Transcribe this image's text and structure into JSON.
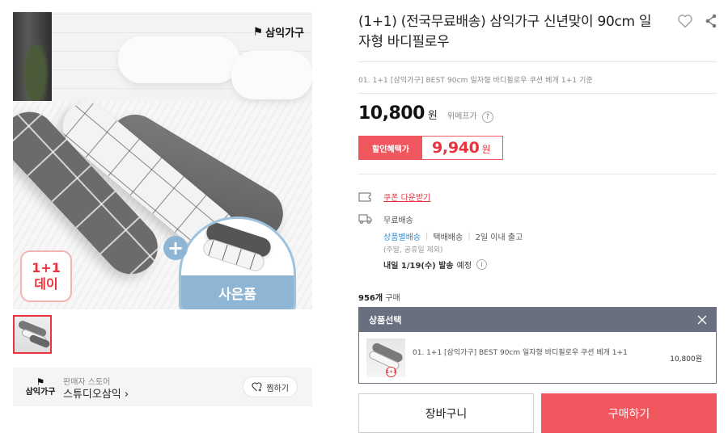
{
  "product": {
    "title": "(1+1) (전국무료배송) 삼익가구 신년맞이 90cm 일자형 바디필로우",
    "option_summary": "01. 1+1 [삼익가구] BEST 90cm 일자형 바디필로우 쿠션 베개 1+1 기준",
    "image": {
      "brand_logo": "삼익가구",
      "badge_line1": "1+1",
      "badge_line2": "데이",
      "gift_label": "사은품",
      "gift_plus": "+"
    }
  },
  "price": {
    "amount": "10,800",
    "currency": "원",
    "tag": "위메프가",
    "help_icon": "?",
    "discount_label": "할인혜택가",
    "discount_amount": "9,940",
    "discount_currency": "원"
  },
  "coupon": {
    "label": "쿠폰 다운받기",
    "icon": "ticket-icon"
  },
  "shipping": {
    "free": "무료배송",
    "method": "상품별배송",
    "carrier": "택배배송",
    "lead": "2일 이내 출고",
    "note": "(주말, 공휴일 제외)",
    "date_bold": "내일 1/19(수) 발송",
    "date_suffix": "예정",
    "info_icon": "i",
    "icon": "truck-icon"
  },
  "sold": {
    "count": "956개",
    "suffix": "구매"
  },
  "options": {
    "header": "상품선택",
    "items": [
      {
        "name": "01. 1+1 [삼익가구] BEST 90cm 일자형 바디필로우 쿠션 베개 1+1",
        "price": "10,800원",
        "thumb_badge": "1+1"
      }
    ]
  },
  "seller": {
    "label": "판매자 스토어",
    "name": "스튜디오삼익 ›",
    "logo_text": "삼익가구",
    "follow_label": "찜하기"
  },
  "buttons": {
    "cart": "장바구니",
    "buy": "구매하기"
  },
  "colors": {
    "accent": "#f0565d",
    "discount_text": "#e8343f",
    "option_header": "#68707f",
    "link_blue": "#2b8fd8"
  }
}
